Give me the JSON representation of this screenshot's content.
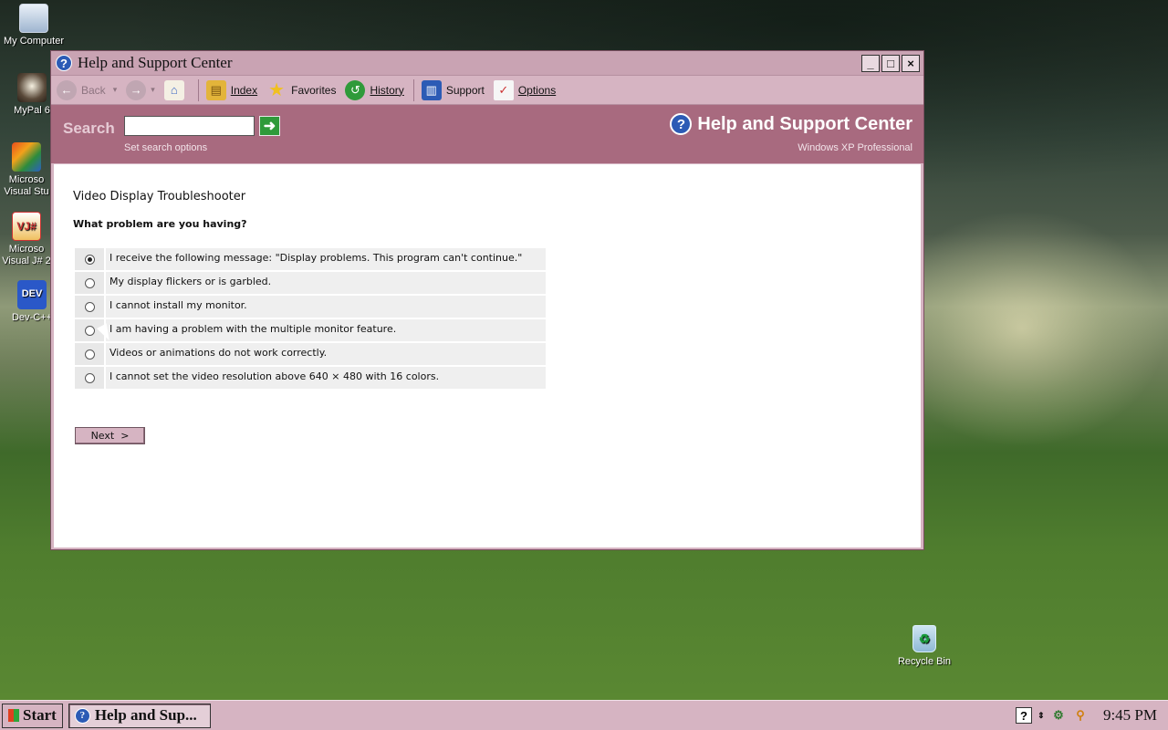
{
  "desktop": {
    "icons": [
      {
        "label": "My Computer",
        "icon": "computer-icon"
      },
      {
        "label": "MyPal 6",
        "icon": "mypal-icon"
      },
      {
        "label": "Microso Visual Stu",
        "icon": "visual-studio-icon"
      },
      {
        "label": "Microso Visual J# 2",
        "icon": "visual-jsharp-icon"
      },
      {
        "label": "Dev-C++",
        "icon": "devcpp-icon"
      }
    ],
    "recycle_bin": "Recycle Bin"
  },
  "window": {
    "title": "Help and Support Center",
    "controls": {
      "minimize": "_",
      "maximize": "□",
      "close": "×"
    },
    "toolbar": {
      "back": "Back",
      "index": "Index",
      "favorites": "Favorites",
      "history": "History",
      "support": "Support",
      "options": "Options"
    },
    "search": {
      "label": "Search",
      "value": "",
      "set_options": "Set search options",
      "brand_title": "Help and Support Center",
      "brand_sub": "Windows XP Professional"
    },
    "content": {
      "title": "Video Display Troubleshooter",
      "question": "What problem are you having?",
      "options": [
        {
          "text": "I receive the following message: \"Display problems. This program can't continue.\"",
          "checked": true
        },
        {
          "text": "My display flickers or is garbled.",
          "checked": false
        },
        {
          "text": "I cannot install my monitor.",
          "checked": false
        },
        {
          "text": "I am having a problem with the multiple monitor feature.",
          "checked": false
        },
        {
          "text": "Videos or animations do not work correctly.",
          "checked": false
        },
        {
          "text": "I cannot set the video resolution above 640 × 480 with 16 colors.",
          "checked": false
        }
      ],
      "next_label": "Next  >"
    }
  },
  "taskbar": {
    "start": "Start",
    "task": "Help and Sup...",
    "clock": "9:45 PM"
  },
  "colors": {
    "window_frame": "#d6b4c2",
    "search_band": "#a86a7f",
    "accent_blue": "#2c5bb5"
  }
}
